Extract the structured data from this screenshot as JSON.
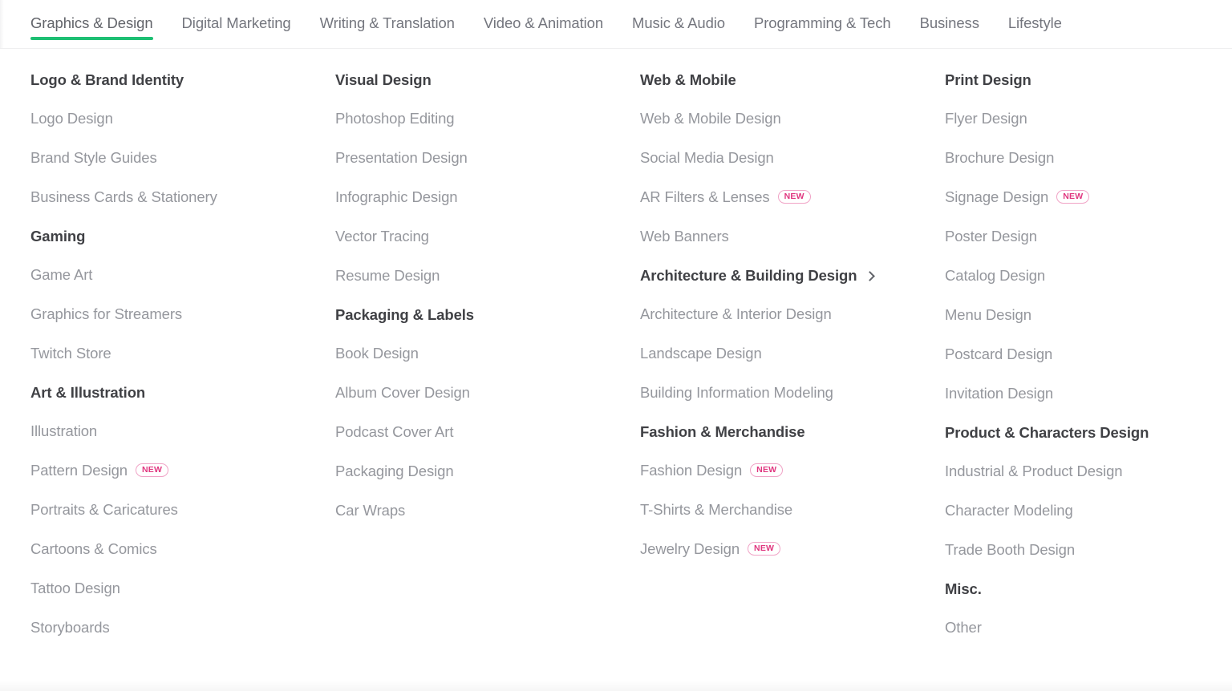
{
  "nav": {
    "active_tab": "Graphics & Design",
    "accent_color": "#1dbf73",
    "tabs": [
      {
        "label": "Graphics & Design",
        "active": true
      },
      {
        "label": "Digital Marketing",
        "active": false
      },
      {
        "label": "Writing & Translation",
        "active": false
      },
      {
        "label": "Video & Animation",
        "active": false
      },
      {
        "label": "Music & Audio",
        "active": false
      },
      {
        "label": "Programming & Tech",
        "active": false
      },
      {
        "label": "Business",
        "active": false
      },
      {
        "label": "Lifestyle",
        "active": false
      }
    ]
  },
  "badge_label": "NEW",
  "badge_color": "#e0367f",
  "columns": [
    {
      "groups": [
        {
          "title": "Logo & Brand Identity",
          "has_chevron": false,
          "items": [
            {
              "label": "Logo Design",
              "badge": null
            },
            {
              "label": "Brand Style Guides",
              "badge": null
            },
            {
              "label": "Business Cards & Stationery",
              "badge": null
            }
          ]
        },
        {
          "title": "Gaming",
          "has_chevron": false,
          "items": [
            {
              "label": "Game Art",
              "badge": null
            },
            {
              "label": "Graphics for Streamers",
              "badge": null
            },
            {
              "label": "Twitch Store",
              "badge": null
            }
          ]
        },
        {
          "title": "Art & Illustration",
          "has_chevron": false,
          "items": [
            {
              "label": "Illustration",
              "badge": null
            },
            {
              "label": "Pattern Design",
              "badge": "NEW"
            },
            {
              "label": "Portraits & Caricatures",
              "badge": null
            },
            {
              "label": "Cartoons & Comics",
              "badge": null
            },
            {
              "label": "Tattoo Design",
              "badge": null
            },
            {
              "label": "Storyboards",
              "badge": null
            }
          ]
        }
      ]
    },
    {
      "groups": [
        {
          "title": "Visual Design",
          "has_chevron": false,
          "items": [
            {
              "label": "Photoshop Editing",
              "badge": null
            },
            {
              "label": "Presentation Design",
              "badge": null
            },
            {
              "label": "Infographic Design",
              "badge": null
            },
            {
              "label": "Vector Tracing",
              "badge": null
            },
            {
              "label": "Resume Design",
              "badge": null
            }
          ]
        },
        {
          "title": "Packaging & Labels",
          "has_chevron": false,
          "items": [
            {
              "label": "Book Design",
              "badge": null
            },
            {
              "label": "Album Cover Design",
              "badge": null
            },
            {
              "label": "Podcast Cover Art",
              "badge": null
            },
            {
              "label": "Packaging Design",
              "badge": null
            },
            {
              "label": "Car Wraps",
              "badge": null
            }
          ]
        }
      ]
    },
    {
      "groups": [
        {
          "title": "Web & Mobile",
          "has_chevron": false,
          "items": [
            {
              "label": "Web & Mobile Design",
              "badge": null
            },
            {
              "label": "Social Media Design",
              "badge": null
            },
            {
              "label": "AR Filters & Lenses",
              "badge": "NEW"
            },
            {
              "label": "Web Banners",
              "badge": null
            }
          ]
        },
        {
          "title": "Architecture & Building Design",
          "has_chevron": true,
          "items": [
            {
              "label": "Architecture & Interior Design",
              "badge": null
            },
            {
              "label": "Landscape Design",
              "badge": null
            },
            {
              "label": "Building Information Modeling",
              "badge": null
            }
          ]
        },
        {
          "title": "Fashion & Merchandise",
          "has_chevron": false,
          "items": [
            {
              "label": "Fashion Design",
              "badge": "NEW"
            },
            {
              "label": "T-Shirts & Merchandise",
              "badge": null
            },
            {
              "label": "Jewelry Design",
              "badge": "NEW"
            }
          ]
        }
      ]
    },
    {
      "groups": [
        {
          "title": "Print Design",
          "has_chevron": false,
          "items": [
            {
              "label": "Flyer Design",
              "badge": null
            },
            {
              "label": "Brochure Design",
              "badge": null
            },
            {
              "label": "Signage Design",
              "badge": "NEW"
            },
            {
              "label": "Poster Design",
              "badge": null
            },
            {
              "label": "Catalog Design",
              "badge": null
            },
            {
              "label": "Menu Design",
              "badge": null
            },
            {
              "label": "Postcard Design",
              "badge": null
            },
            {
              "label": "Invitation Design",
              "badge": null
            }
          ]
        },
        {
          "title": "Product & Characters Design",
          "has_chevron": false,
          "items": [
            {
              "label": "Industrial & Product Design",
              "badge": null
            },
            {
              "label": "Character Modeling",
              "badge": null
            },
            {
              "label": "Trade Booth Design",
              "badge": null
            }
          ]
        },
        {
          "title": "Misc.",
          "has_chevron": false,
          "items": [
            {
              "label": "Other",
              "badge": null
            }
          ]
        }
      ]
    }
  ]
}
